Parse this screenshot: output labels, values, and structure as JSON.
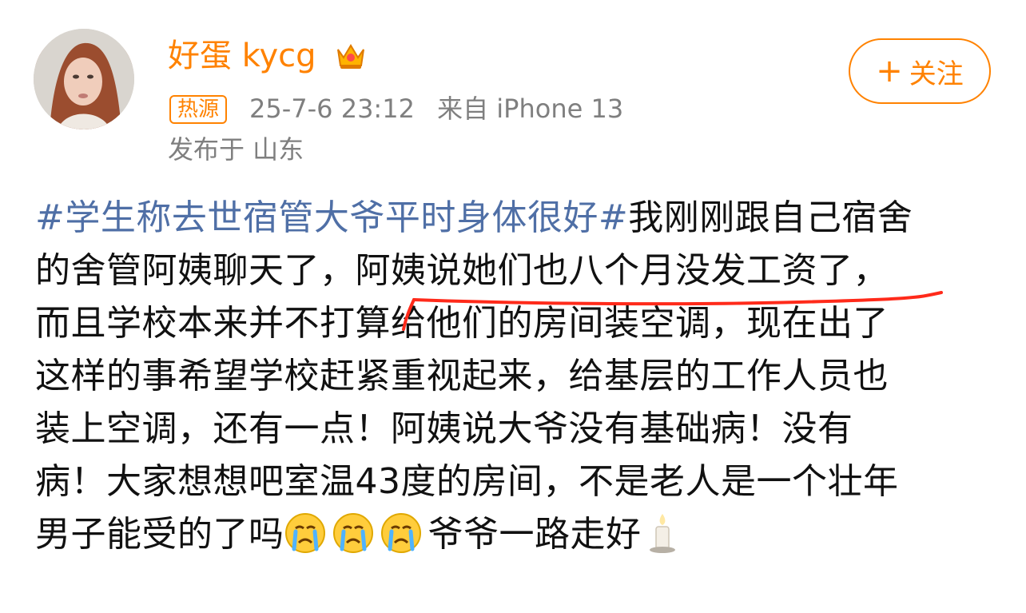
{
  "user": {
    "name": "好蛋 kycg",
    "badge": "热源",
    "timestamp": "25-7-6 23:12",
    "source": "来自 iPhone 13",
    "location": "发布于 山东"
  },
  "follow": {
    "label": "关注",
    "plus": "+"
  },
  "post": {
    "topic": "#学生称去世宿管大爷平时身体很好#",
    "line1_rest": "我刚刚跟自己宿舍",
    "line2": "的舍管阿姨聊天了，阿姨说她们也八个月没发工资了，",
    "line3": "而且学校本来并不打算给他们的房间装空调，现在出了",
    "line4": "这样的事希望学校赶紧重视起来，给基层的工作人员也",
    "line5": "装上空调，还有一点！阿姨说大爷没有基础病！没有",
    "line6": "病！大家想想吧室温43度的房间，不是老人是一个壮年",
    "line7_before": "男子能受的了吗",
    "line7_after": "爷爷一路走好"
  },
  "colors": {
    "accent": "#ff8200",
    "topic": "#4f6fa6",
    "meta": "#7f7f7f",
    "annotation": "#ff2a1a"
  },
  "icons": {
    "crown": "crown-icon",
    "crying": "crying-face-icon",
    "candle": "candle-icon"
  }
}
